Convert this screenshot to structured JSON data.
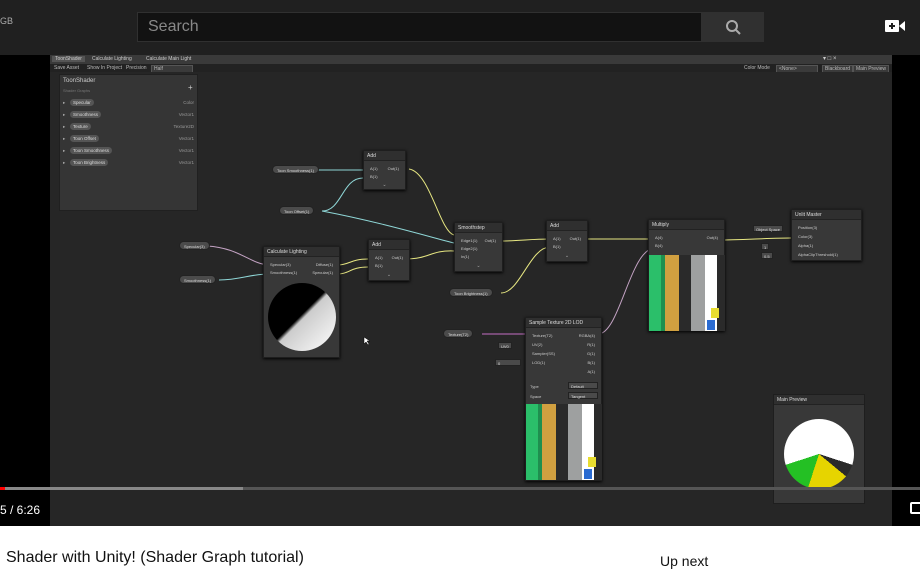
{
  "top_bar": {
    "left_fragment": "GB",
    "search_placeholder": "Search",
    "search_icon": "search-icon",
    "create_icon": "video-camera-plus-icon"
  },
  "editor": {
    "tabs": [
      "ToonShader",
      "Calculate Lighting",
      "Calculate Main Light"
    ],
    "toolbar": {
      "save_asset": "Save Asset",
      "show_in_project": "Show In Project",
      "precision_label": "Precision",
      "precision_value": "Half",
      "color_mode_label": "Color Mode",
      "color_mode_value": "<None>",
      "blackboard": "Blackboard",
      "main_preview": "Main Preview"
    },
    "blackboard": {
      "title": "ToonShader",
      "subtitle": "Shader Graphs",
      "add": "+",
      "properties": [
        {
          "name": "Specular",
          "type": "Color"
        },
        {
          "name": "Smoothness",
          "type": "Vector1"
        },
        {
          "name": "Texture",
          "type": "Texture2D"
        },
        {
          "name": "Toon Offset",
          "type": "Vector1"
        },
        {
          "name": "Toon Smoothness",
          "type": "Vector1"
        },
        {
          "name": "Toon Brightness",
          "type": "Vector1"
        }
      ]
    },
    "nodes": {
      "add1": {
        "title": "Add",
        "in_a": "A(1)",
        "in_b": "B(1)",
        "out": "Out(1)"
      },
      "add2": {
        "title": "Add",
        "in_a": "A(1)",
        "in_b": "B(1)",
        "out": "Out(1)"
      },
      "add3": {
        "title": "Add",
        "in_a": "A(1)",
        "in_b": "B(1)",
        "out": "Out(1)"
      },
      "smoothstep": {
        "title": "Smoothstep",
        "in1": "Edge1(1)",
        "in2": "Edge2(1)",
        "in3": "In(1)",
        "out": "Out(1)"
      },
      "lighting": {
        "title": "Calculate Lighting",
        "in1": "Specular(3)",
        "in2": "Smoothness(1)",
        "out1": "Diffuse(1)",
        "out2": "Specular(1)"
      },
      "multiply": {
        "title": "Multiply",
        "in_a": "A(4)",
        "in_b": "B(4)",
        "out": "Out(4)"
      },
      "unlit": {
        "title": "Unlit Master",
        "inputs": [
          "Position(3)",
          "Color(3)",
          "Alpha(1)",
          "AlphaClipThreshold(1)"
        ],
        "space": "Object Space",
        "alpha_val": "1",
        "clip_val": "0.5"
      },
      "sample": {
        "title": "Sample Texture 2D LOD",
        "inputs": [
          "Texture(T2)",
          "UV(2)",
          "Sampler(SS)",
          "LOD(1)"
        ],
        "outputs": [
          "RGBA(4)",
          "R(1)",
          "G(1)",
          "B(1)",
          "A(1)"
        ],
        "uv_field": "UV0",
        "lod_field": "0",
        "type_label": "Type",
        "type_value": "Default",
        "space_label": "Space",
        "space_value": "Tangent"
      }
    },
    "property_nodes": {
      "toon_smoothness": "Toon Smoothness(1)",
      "toon_offset": "Toon Offset(1)",
      "specular": "Specular(3)",
      "smoothness": "Smoothness(1)",
      "toon_brightness": "Toon Brightness(1)",
      "texture": "Texture(T2)"
    },
    "main_preview_title": "Main Preview"
  },
  "player": {
    "time": "5 / 6:26",
    "progress_fraction": 0.264
  },
  "below": {
    "video_title": "Shader with Unity! (Shader Graph tutorial)",
    "up_next": "Up next"
  }
}
